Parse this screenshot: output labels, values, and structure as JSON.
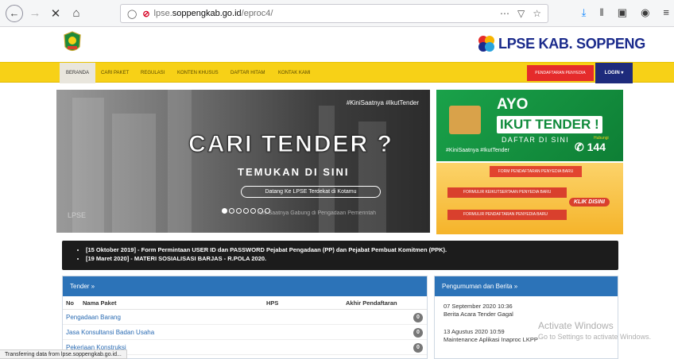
{
  "browser": {
    "url_prefix": "lpse.",
    "url_domain": "soppengkab.go.id",
    "url_path": "/eproc4/",
    "status_text": "Transferring data from lpse.soppengkab.go.id..."
  },
  "header": {
    "brand_lpse": "LPSE",
    "brand_name": "KAB. SOPPENG"
  },
  "menu": {
    "items": [
      "BERANDA",
      "CARI PAKET",
      "REGULASI",
      "KONTEN KHUSUS",
      "DAFTAR HITAM",
      "KONTAK KAMI"
    ],
    "registration": "PENDAFTARAN PENYEDIA",
    "login": "LOGIN"
  },
  "hero": {
    "hashtag": "#KiniSaatnya #IkutTender",
    "title": "CARI TENDER ?",
    "subtitle": "TEMUKAN DI SINI",
    "pill": "Datang Ke LPSE Terdekat di Kotamu",
    "caption": "Kini Saatnya Gabung di Pengadaan Pemerintah",
    "watermark": "LPSE",
    "slide_count": 7,
    "active_slide": 1
  },
  "promo1": {
    "ayo": "AYO",
    "ikut": "IKUT TENDER !",
    "daftar": "DAFTAR DI SINI",
    "hashtag": "#KiniSaatnya #IkutTender",
    "hubungi": "Hubungi",
    "hotline": "144"
  },
  "promo2": {
    "top": "FORM PENDAFTARAN PENYEDIA BARU",
    "row1": "FORMULIR KEIKUTSERTAAN PENYEDIA BARU",
    "row2": "FORMULIR PENDAFTARAN PENYEDIA BARU",
    "klik": "KLIK DISINI"
  },
  "ticker": {
    "items": [
      "[15 Oktober 2019] - Form Permintaan USER ID dan PASSWORD Pejabat Pengadaan (PP) dan Pejabat Pembuat Komitmen (PPK).",
      "[19 Maret 2020] - MATERI SOSIALISASI BARJAS - R.POLA 2020."
    ]
  },
  "tender": {
    "title": "Tender »",
    "col_no": "No",
    "col_nama": "Nama Paket",
    "col_hps": "HPS",
    "col_akhir": "Akhir Pendaftaran",
    "rows": [
      {
        "label": "Pengadaan Barang",
        "count": "0"
      },
      {
        "label": "Jasa Konsultansi Badan Usaha",
        "count": "0"
      },
      {
        "label": "Pekerjaan Konstruksi",
        "count": "0"
      }
    ]
  },
  "pengumuman": {
    "title": "Pengumuman dan Berita »",
    "entries": [
      {
        "date": "07 September 2020 10:36",
        "text": "Berita Acara Tender Gagal"
      },
      {
        "date": "13 Agustus 2020 10:59",
        "text": "Maintenance Aplikasi Inaproc LKPP"
      }
    ]
  },
  "windows": {
    "activate": "Activate Windows",
    "goto": "Go to Settings to activate Windows."
  }
}
